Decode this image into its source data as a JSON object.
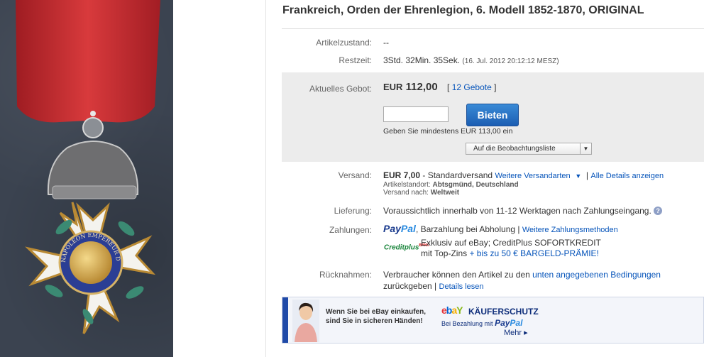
{
  "title": "Frankreich, Orden der Ehrenlegion, 6. Modell 1852-1870, ORIGINAL",
  "medal_inscription": "NAPOLEON EMPEREUR DES FRANCAIS",
  "condition": {
    "label": "Artikelzustand:",
    "value": "--"
  },
  "time_left": {
    "label": "Restzeit:",
    "value": "3Std. 32Min. 35Sek.",
    "end": "(16. Jul. 2012 20:12:12 MESZ)"
  },
  "bid": {
    "label": "Aktuelles Gebot:",
    "currency": "EUR",
    "amount": "112,00",
    "count_open": "[",
    "count_link": "12 Gebote",
    "count_close": "]",
    "input_value": "",
    "button": "Bieten",
    "min_text": "Geben Sie mindestens EUR 113,00 ein",
    "watchlist": "Auf die Beobachtungsliste"
  },
  "shipping": {
    "label": "Versand:",
    "price": "EUR 7,00",
    "method": " - Standardversand",
    "more_link": "Weitere Versandarten",
    "separator": "|",
    "details_link": "Alle Details anzeigen",
    "location_label": "Artikelstandort:",
    "location": "Abtsgmünd, Deutschland",
    "to_label": "Versand nach:",
    "to": "Weltweit"
  },
  "delivery": {
    "label": "Lieferung:",
    "value": "Voraussichtlich innerhalb von 11-12 Werktagen nach Zahlungseingang.",
    "help": "?"
  },
  "payment": {
    "label": "Zahlungen:",
    "paypal_a": "Pay",
    "paypal_b": "Pal",
    "other": ", Barzahlung bei Abholung |",
    "more_link": "Weitere Zahlungsmethoden",
    "credit_logo": "Creditplus",
    "credit_logo_tag": "BANK",
    "credit_line1": "Exklusiv auf eBay; CreditPlus SOFORTKREDIT",
    "credit_line2a": "mit Top-Zins ",
    "credit_line2b": "+ bis zu 50 € BARGELD-PRÄMIE!"
  },
  "returns": {
    "label": "Rücknahmen:",
    "text_a": "Verbraucher können den Artikel zu den ",
    "link": "unten angegebenen Bedingungen",
    "text_b": "zurückgeben |",
    "details_link": "Details lesen"
  },
  "banner": {
    "line1": "Wenn Sie bei eBay einkaufen,",
    "line2": "sind Sie in sicheren Händen!",
    "logo_e": "e",
    "logo_b": "b",
    "logo_a": "a",
    "logo_y": "Y",
    "kauf": "KÄUFERSCHUTZ",
    "bez": "Bei Bezahlung mit",
    "pp_a": "Pay",
    "pp_b": "Pal",
    "mehr": "Mehr ▸"
  },
  "colors": {
    "link": "#0654ba",
    "bid_button": "#1c5eb3",
    "bid_box": "#ececec",
    "ribbon": "#c8282c"
  }
}
